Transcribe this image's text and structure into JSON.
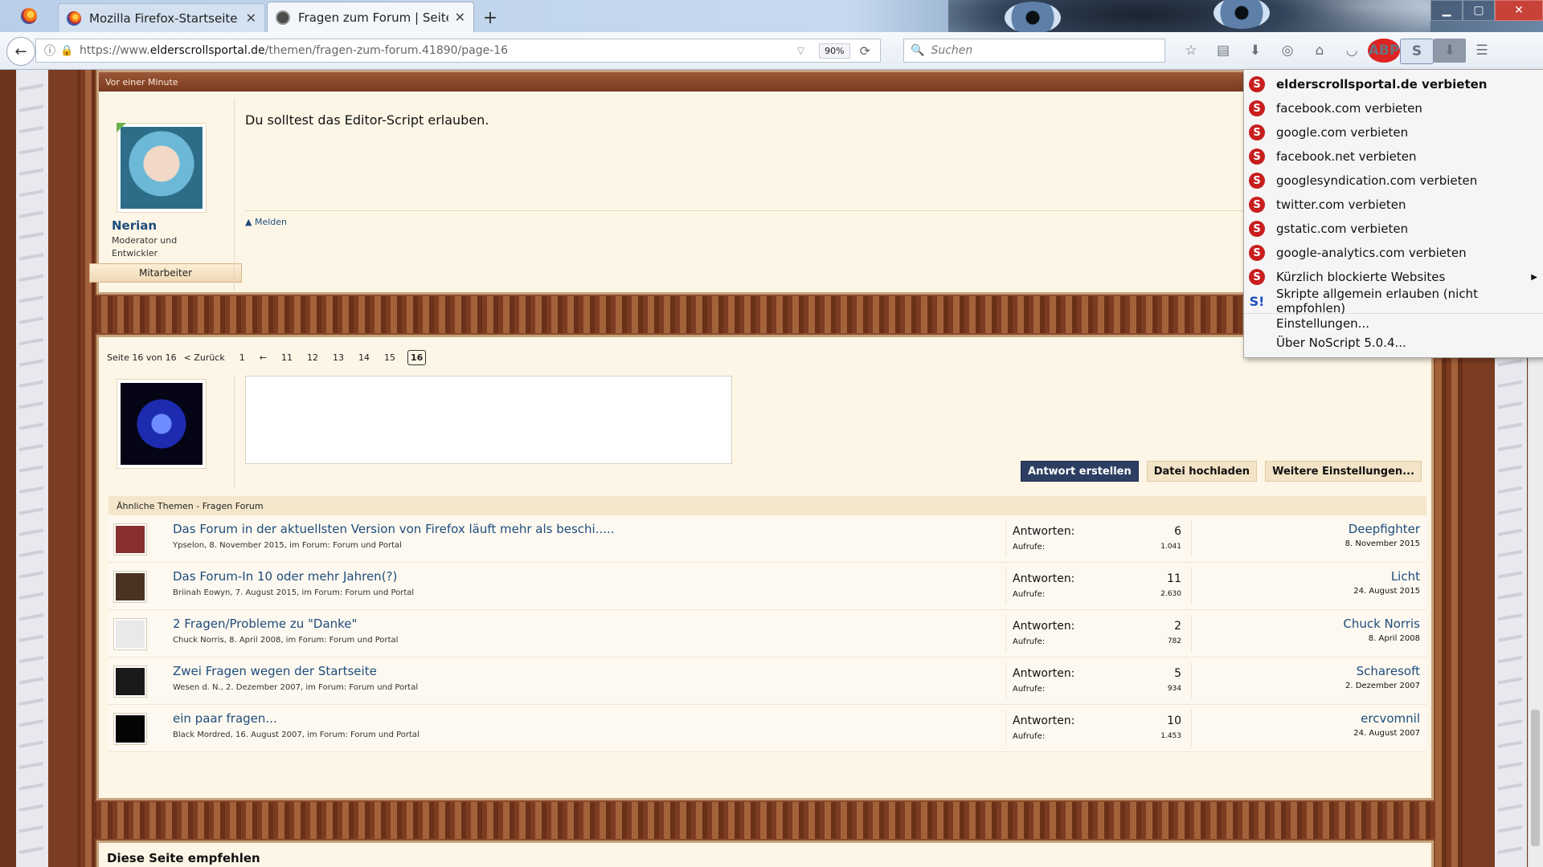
{
  "browser": {
    "tabs": [
      {
        "label": "Mozilla Firefox-Startseite",
        "active": false
      },
      {
        "label": "Fragen zum Forum | Seite 16",
        "active": true
      }
    ],
    "url_prefix": "https://www.",
    "url_domain": "elderscrollsportal.de",
    "url_path": "/themen/fragen-zum-forum.41890/page-16",
    "zoom": "90%",
    "search_placeholder": "Suchen",
    "abp_label": "ABP",
    "noscript_label": "S"
  },
  "post": {
    "time": "Vor einer Minute",
    "author": "Nerian",
    "author_title": "Moderator und Entwickler",
    "badge": "Mitarbeiter",
    "message": "Du solltest das Editor-Script erlauben.",
    "report": "Melden"
  },
  "pagination": {
    "label": "Seite 16 von 16",
    "prev": "< Zurück",
    "pages": [
      "1",
      "←",
      "11",
      "12",
      "13",
      "14",
      "15",
      "16"
    ],
    "current": "16"
  },
  "reply": {
    "buttons": {
      "submit": "Antwort erstellen",
      "upload": "Datei hochladen",
      "more": "Weitere Einstellungen..."
    }
  },
  "similar": {
    "header": "Ähnliche Themen - Fragen Forum",
    "replies_label": "Antworten:",
    "views_label": "Aufrufe:",
    "threads": [
      {
        "title": "Das Forum in der aktuellsten Version von Firefox läuft mehr als beschi.....",
        "meta": "Ypselon, 8. November 2015, im Forum: Forum und Portal",
        "replies": "6",
        "views": "1.041",
        "last_user": "Deepfighter",
        "last_date": "8. November 2015",
        "thumb": "#8a2f2f"
      },
      {
        "title": "Das Forum-In 10 oder mehr Jahren(?)",
        "meta": "Briinah Eowyn, 7. August 2015, im Forum: Forum und Portal",
        "replies": "11",
        "views": "2.630",
        "last_user": "Licht",
        "last_date": "24. August 2015",
        "thumb": "#4a3322"
      },
      {
        "title": "2 Fragen/Probleme zu \"Danke\"",
        "meta": "Chuck Norris, 8. April 2008, im Forum: Forum und Portal",
        "replies": "2",
        "views": "782",
        "last_user": "Chuck Norris",
        "last_date": "8. April 2008",
        "thumb": "#e9e9e9"
      },
      {
        "title": "Zwei Fragen wegen der Startseite",
        "meta": "Wesen d. N., 2. Dezember 2007, im Forum: Forum und Portal",
        "replies": "5",
        "views": "934",
        "last_user": "Scharesoft",
        "last_date": "2. Dezember 2007",
        "thumb": "#1a1a1a"
      },
      {
        "title": "ein paar fragen...",
        "meta": "Black Mordred, 16. August 2007, im Forum: Forum und Portal",
        "replies": "10",
        "views": "1.453",
        "last_user": "ercvomnil",
        "last_date": "24. August 2007",
        "thumb": "#050505"
      }
    ]
  },
  "bottom": {
    "title": "Diese Seite empfehlen"
  },
  "noscript_menu": {
    "items": [
      {
        "label": "elderscrollsportal.de verbieten",
        "bold": true
      },
      {
        "label": "facebook.com verbieten"
      },
      {
        "label": "google.com verbieten"
      },
      {
        "label": "facebook.net verbieten"
      },
      {
        "label": "googlesyndication.com verbieten"
      },
      {
        "label": "twitter.com verbieten"
      },
      {
        "label": "gstatic.com verbieten"
      },
      {
        "label": "google-analytics.com verbieten"
      }
    ],
    "recent": "Kürzlich blockierte Websites",
    "allow_all": "Skripte allgemein erlauben (nicht empfohlen)",
    "settings": "Einstellungen...",
    "about": "Über NoScript 5.0.4..."
  }
}
